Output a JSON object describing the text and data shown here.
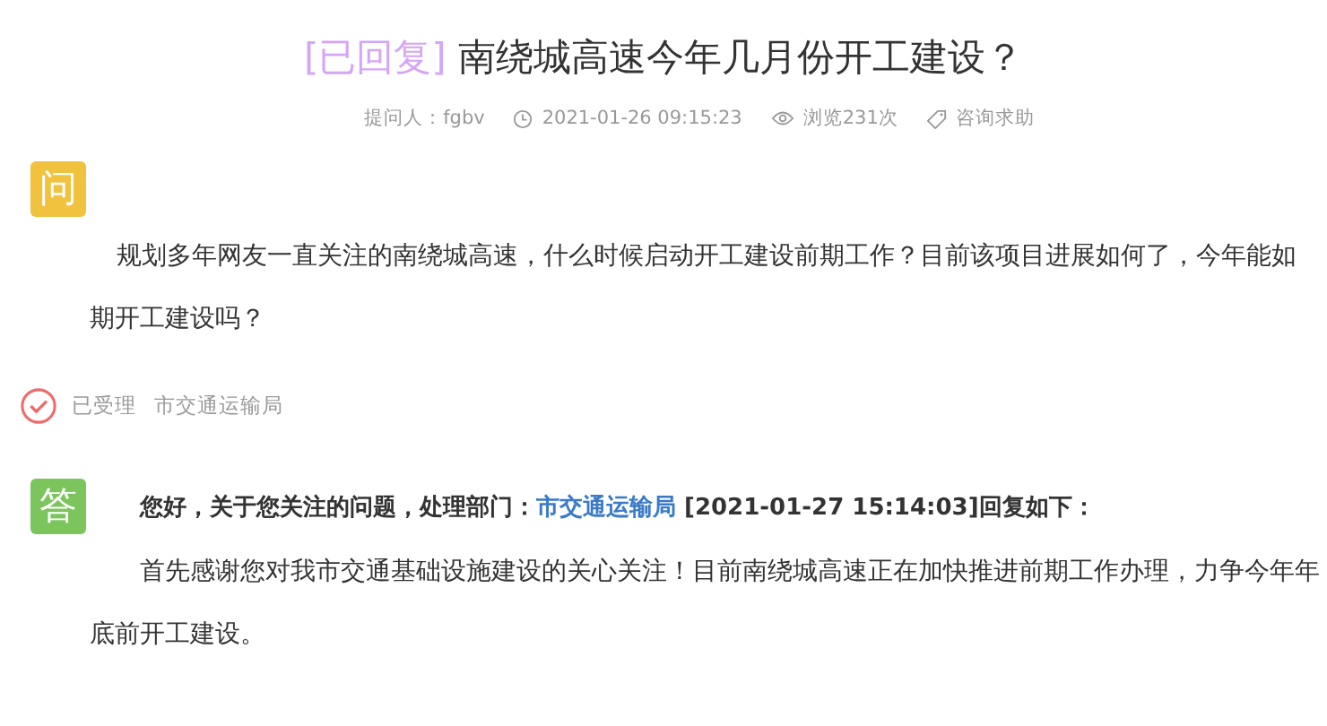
{
  "title": {
    "tag": "[已回复]",
    "text": "南绕城高速今年几月份开工建设？"
  },
  "meta": [
    {
      "kind": "asker",
      "text": "提问人：fgbv"
    },
    {
      "kind": "time",
      "text": "2021-01-26 09:15:23"
    },
    {
      "kind": "views",
      "text": "浏览231次"
    },
    {
      "kind": "category",
      "text": "咨询求助"
    }
  ],
  "question": {
    "badge": "问",
    "text": "规划多年网友一直关注的南绕城高速，什么时候启动开工建设前期工作？目前该项目进展如何了，今年能如期开工建设吗？"
  },
  "status": {
    "accepted": true,
    "label": "已受理",
    "department": "市交通运输局"
  },
  "answer": {
    "badge": "答",
    "header_before": "您好，关于您关注的问题，处理部门：",
    "department_link": "市交通运输局",
    "header_after": " [2021-01-27 15:14:03]回复如下：",
    "text": "首先感谢您对我市交通基础设施建设的关心关注！目前南绕城高速正在加快推进前期工作办理，力争今年年底前开工建设。"
  }
}
